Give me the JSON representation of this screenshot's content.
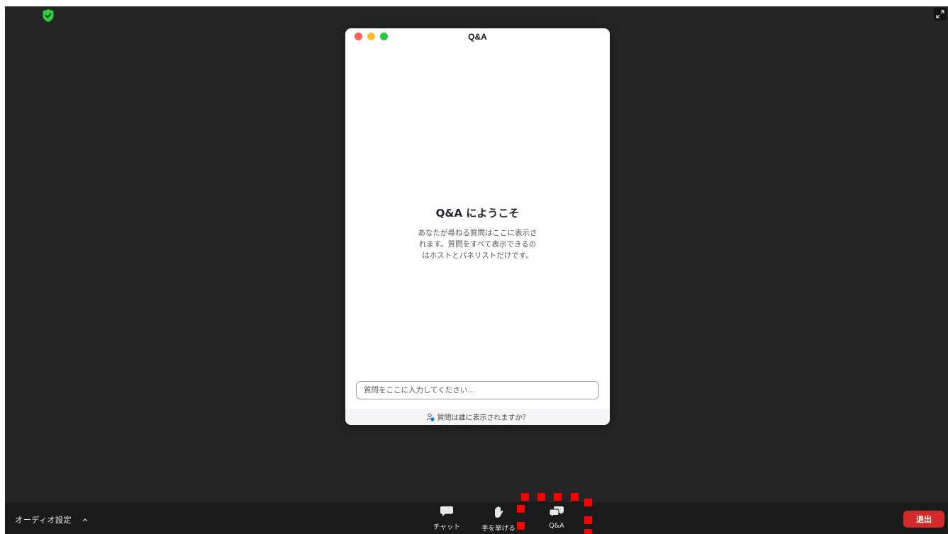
{
  "qa_window": {
    "title": "Q&A",
    "welcome_title": "Q&A にようこそ",
    "welcome_lines": [
      "あなたが尋ねる質問はここに表示さ",
      "れます。質問をすべて表示できるの",
      "はホストとパネリストだけです。"
    ],
    "input_placeholder": "質問をここに入力してください...",
    "visibility_link": "質問は誰に表示されますか？"
  },
  "toolbar": {
    "audio_settings": "オーディオ設定",
    "chat_label": "チャット",
    "raise_hand_label": "手を挙げる",
    "qa_label": "Q&A",
    "leave_label": "退出"
  },
  "colors": {
    "background": "#252525",
    "toolbar": "#1a1a1a",
    "leave_button": "#d32a2a",
    "highlight": "#ff0000",
    "shield": "#2ecc40"
  }
}
